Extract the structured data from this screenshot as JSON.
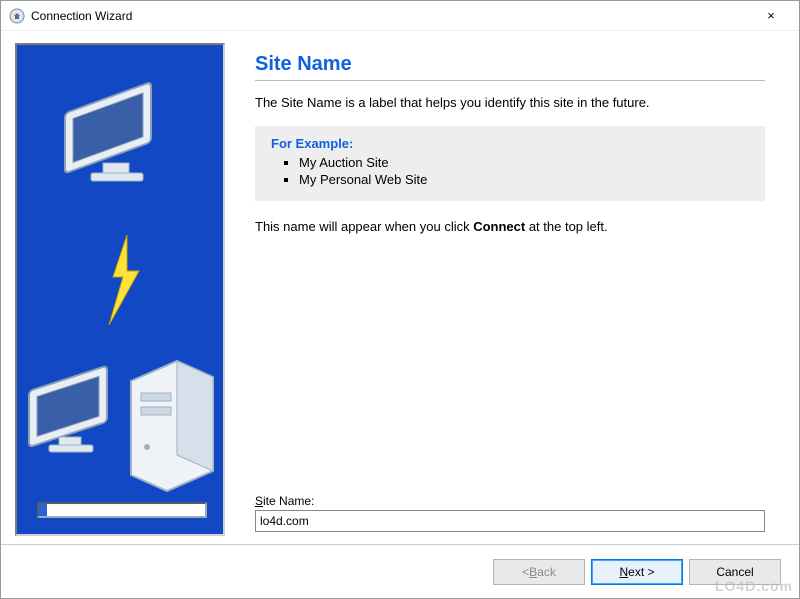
{
  "window": {
    "title": "Connection Wizard",
    "close_symbol": "×"
  },
  "page": {
    "heading": "Site Name",
    "description": "The Site Name is a label that helps you identify this site in the future.",
    "example_label": "For Example:",
    "examples": [
      "My Auction Site",
      "My Personal Web Site"
    ],
    "note_prefix": "This name will appear when you click ",
    "note_bold": "Connect",
    "note_suffix": " at the top left.",
    "field_label_prefix": "S",
    "field_label_rest": "ite Name:",
    "field_value": "lo4d.com"
  },
  "buttons": {
    "back_prefix": "< ",
    "back_u": "B",
    "back_rest": "ack",
    "next_u": "N",
    "next_rest": "ext >",
    "cancel": "Cancel"
  },
  "watermark": "LO4D.com"
}
